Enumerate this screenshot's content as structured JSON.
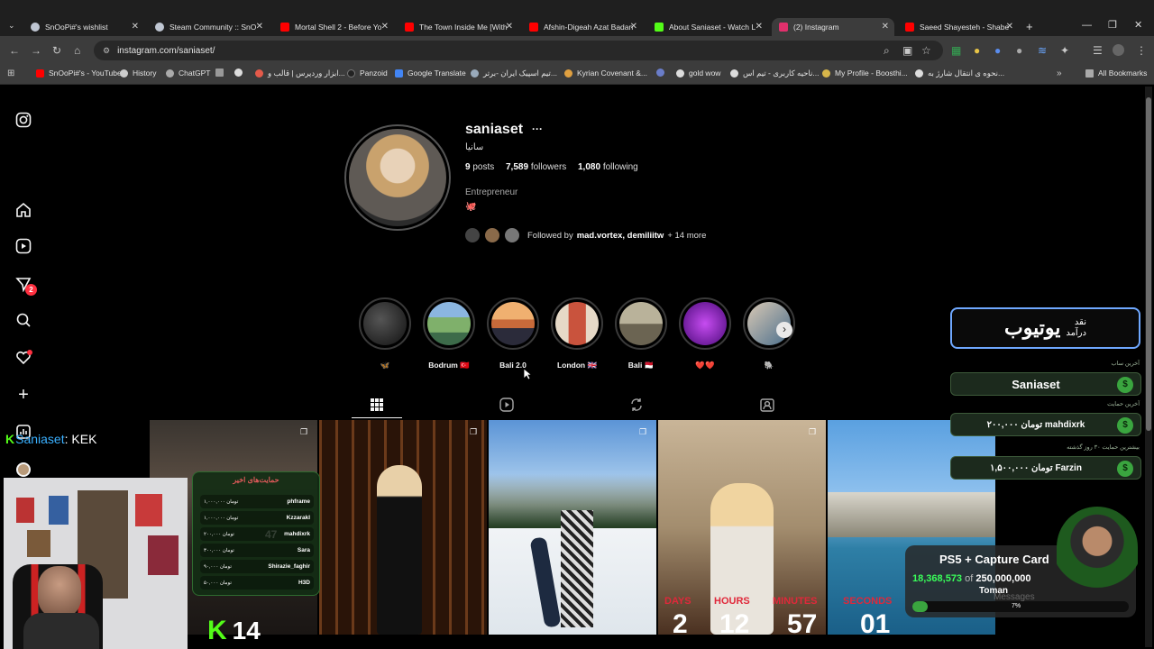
{
  "browser": {
    "tabs": [
      {
        "title": "SnOoPi#'s wishlist",
        "color": "#bfc6d2"
      },
      {
        "title": "Steam Community :: SnO",
        "color": "#bfc6d2"
      },
      {
        "title": "Mortal Shell 2 - Before Yo",
        "color": "#ff0000"
      },
      {
        "title": "The Town Inside Me [With",
        "color": "#ff0000"
      },
      {
        "title": "Afshin-Digeah Azat Badan",
        "color": "#ff0000"
      },
      {
        "title": "About Saniaset - Watch L",
        "color": "#53fc18"
      },
      {
        "title": "(2) Instagram",
        "color": "#e1306c"
      },
      {
        "title": "Saeed Shayesteh - Shabe",
        "color": "#ff0000"
      }
    ],
    "url": "instagram.com/saniaset/",
    "bookmarks": [
      "SnOoPi#'s - YouTube",
      "History",
      "ChatGPT",
      "ابزار وردپرس | قالب و...",
      "Panzoid",
      "Google Translate",
      "تیم اسپیک ایران -برتر...",
      "Kyrian Covenant &...",
      "gold wow",
      "ناحیه کاربری - تیم اس...",
      "My Profile - Boosthi...",
      "نحوه ی انتقال شارژ به..."
    ],
    "all_bookmarks": "All Bookmarks"
  },
  "instagram": {
    "nav_badge": "2",
    "profile": {
      "username": "saniaset",
      "more": "···",
      "display_name": "سانیا",
      "posts_count": "9",
      "posts_label": "posts",
      "followers_count": "7,589",
      "followers_label": "followers",
      "following_count": "1,080",
      "following_label": "following",
      "category": "Entrepreneur",
      "bio_emoji": "🐙",
      "followed_by_prefix": "Followed by",
      "followed_by_names": "mad.vortex, demiliitw",
      "followed_by_more": "+ 14 more"
    },
    "highlights": [
      {
        "label": "🦋",
        "c1": "#2b2b2b",
        "c2": "#111"
      },
      {
        "label": "Bodrum 🇹🇷",
        "c1": "#7fb06b",
        "c2": "#3d6b8a"
      },
      {
        "label": "Bali 2.0",
        "c1": "#e08a4a",
        "c2": "#3a2c4d"
      },
      {
        "label": "London 🇬🇧",
        "c1": "#c9533d",
        "c2": "#e6d9c7"
      },
      {
        "label": "Bali 🇲🇨",
        "c1": "#b9b29a",
        "c2": "#4d4a3c"
      },
      {
        "label": "❤️❤️",
        "c1": "#9a1fd6",
        "c2": "#3b0a5a"
      },
      {
        "label": "🐘",
        "c1": "#d9c9b5",
        "c2": "#4a6e8c"
      }
    ]
  },
  "stream_overlay": {
    "chat_user": "Saniaset",
    "chat_message": "KEK",
    "brand_small_1": "نقد",
    "brand_small_2": "درآمد",
    "brand_big": "یوتیوب",
    "latest_sub_label": "آخرین ساب",
    "latest_sub": "Saniaset",
    "latest_donation_label": "آخرین حمایت",
    "latest_donation": "۲۰۰,۰۰۰ تومان  mahdixrk",
    "top_month_label": "بیشترین حمایت ۳۰ روز گذشته",
    "top_month": "۱,۵۰۰,۰۰۰ تومان  Farzin",
    "donors_title": "حمایت‌های اخیر",
    "donors": [
      {
        "amount": "۱,۰۰۰,۰۰۰ تومان",
        "name": "phframe"
      },
      {
        "amount": "۱,۰۰۰,۰۰۰ تومان",
        "name": "Kzzarakl"
      },
      {
        "amount": "۲۰۰,۰۰۰ تومان",
        "name": "mahdixrk"
      },
      {
        "amount": "۳۰۰,۰۰۰ تومان",
        "name": "Sara"
      },
      {
        "amount": "۹۰,۰۰۰ تومان",
        "name": "Shirazie_faghir"
      },
      {
        "amount": "۵۰,۰۰۰ تومان",
        "name": "H3D"
      }
    ],
    "donors_bg_number": "47",
    "kick_number": "14",
    "goal_title": "PS5 + Capture Card",
    "goal_current": "18,368,573",
    "goal_of": "of",
    "goal_target": "250,000,000",
    "goal_unit": "Toman",
    "goal_percent": "7%",
    "goal_fraction": 0.07,
    "messages_ghost": "Messages",
    "countdown": [
      {
        "label": "DAYS",
        "value": "2"
      },
      {
        "label": "HOURS",
        "value": "12"
      },
      {
        "label": "MINUTES",
        "value": "57"
      },
      {
        "label": "SECONDS",
        "value": "01"
      }
    ]
  }
}
